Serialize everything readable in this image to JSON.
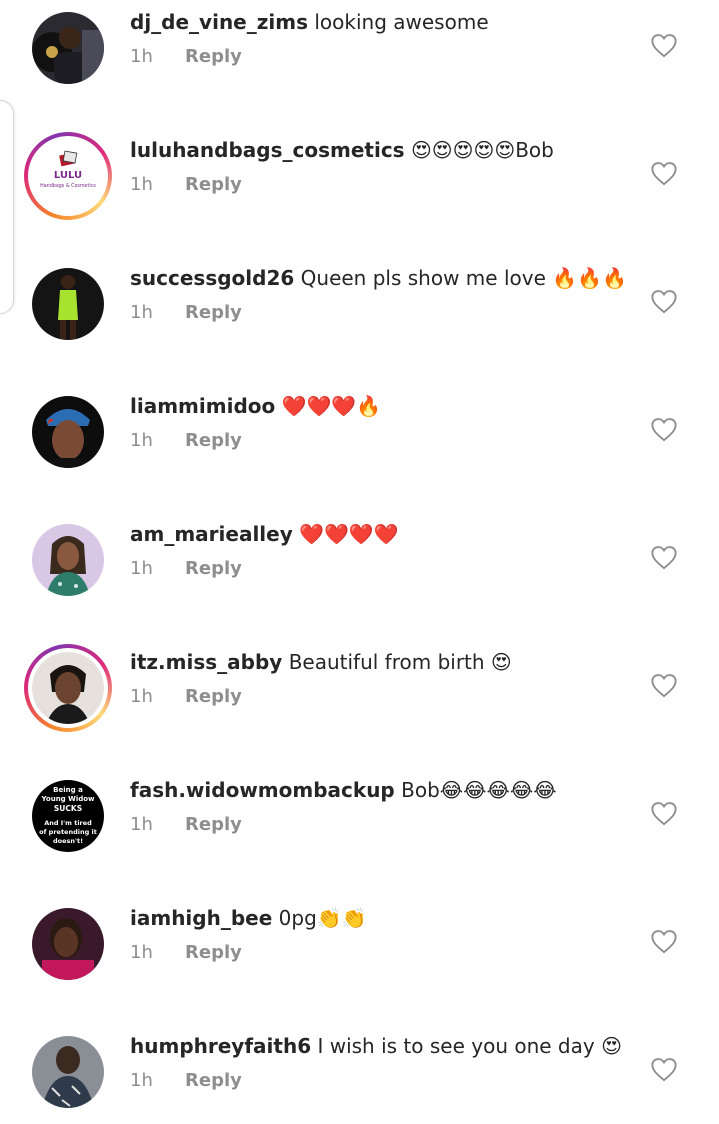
{
  "reply_label": "Reply",
  "comments": [
    {
      "username": "dj_de_vine_zims",
      "text": "looking awesome",
      "time": "1h",
      "avatar": "man-with-vinyl-avatar"
    },
    {
      "username": "luluhandbags_cosmetics",
      "text": "😍😍😍😍😍Bob",
      "time": "1h",
      "avatar": "lulu-logo-avatar",
      "logo_text": "LULU",
      "logo_sub": "Handbags & Cosmetics"
    },
    {
      "username": "successgold26",
      "text": "Queen pls show me love 🔥🔥🔥",
      "time": "1h",
      "avatar": "green-dress-avatar"
    },
    {
      "username": "liammimidoo",
      "text": "❤️❤️❤️🔥",
      "time": "1h",
      "avatar": "woman-headwrap-avatar"
    },
    {
      "username": "am_mariealley",
      "text": "❤️❤️❤️❤️",
      "time": "1h",
      "avatar": "woman-sequin-avatar"
    },
    {
      "username": "itz.miss_abby",
      "text": "Beautiful from birth 😍",
      "time": "1h",
      "avatar": "woman-portrait-avatar"
    },
    {
      "username": "fash.widowmombackup",
      "text": "Bob😂😂😂😂😂",
      "time": "1h",
      "avatar": "text-quote-avatar",
      "avatar_text": [
        "Being a",
        "Young Widow",
        "SUCKS",
        "And I'm tired",
        "of pretending it",
        "doesn't!"
      ]
    },
    {
      "username": "iamhigh_bee",
      "text": "0pg👏👏",
      "time": "1h",
      "avatar": "dark-selfie-avatar"
    },
    {
      "username": "humphreyfaith6",
      "text": "I wish is to see you one day 😍",
      "time": "1h",
      "avatar": "man-patterned-avatar"
    }
  ],
  "colors": {
    "text": "#262626",
    "muted": "#8e8e8e",
    "story_ring": "#dd2a7b"
  }
}
